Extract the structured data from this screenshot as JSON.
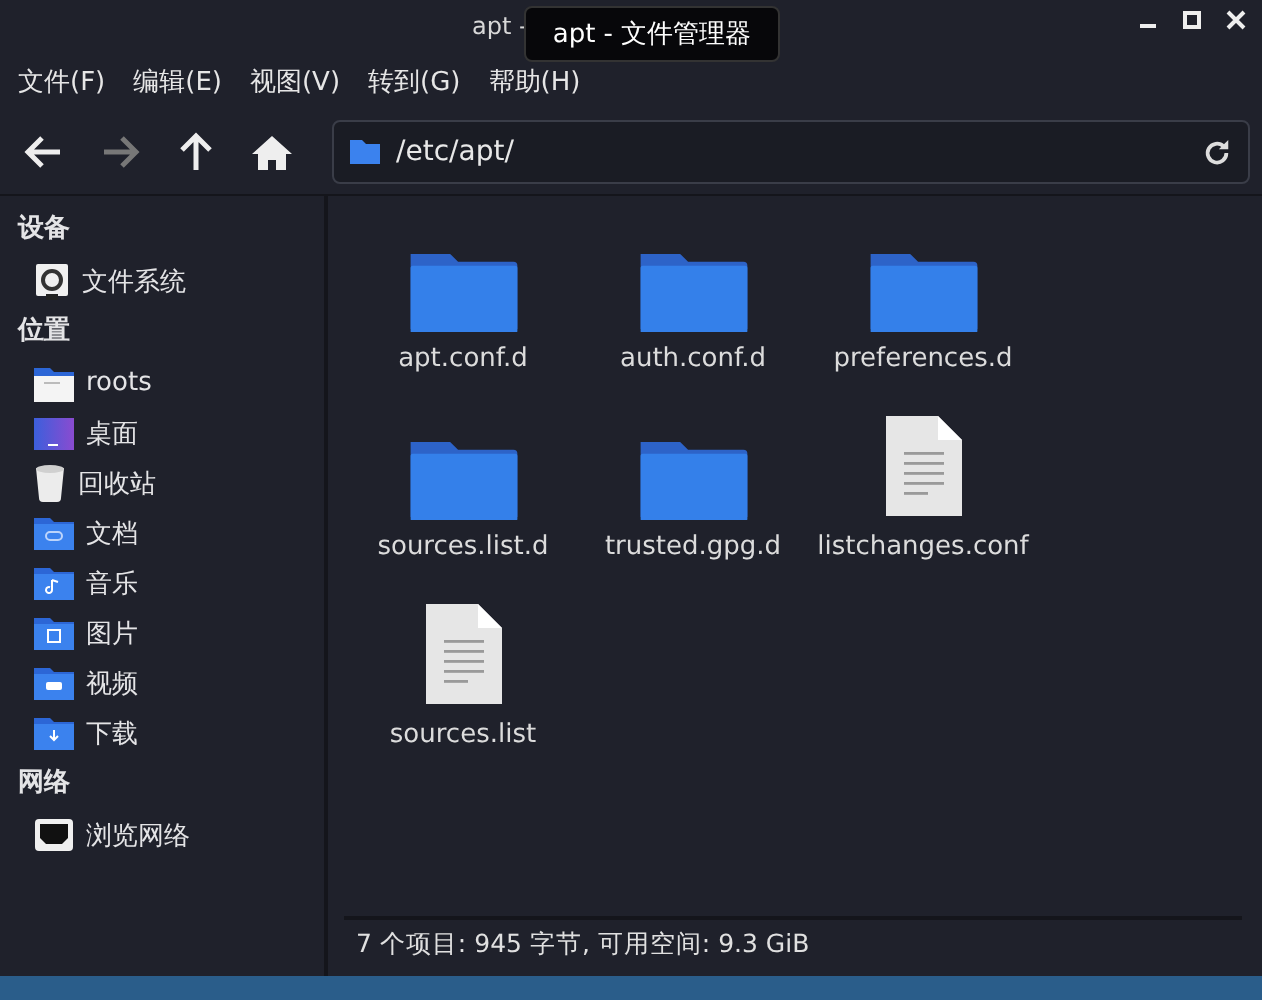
{
  "window": {
    "title": "apt -",
    "tooltip": "apt - 文件管理器"
  },
  "menu": [
    "文件(F)",
    "编辑(E)",
    "视图(V)",
    "转到(G)",
    "帮助(H)"
  ],
  "toolbar": {
    "back": {
      "disabled": false
    },
    "forward": {
      "disabled": true
    },
    "path": "/etc/apt/"
  },
  "sidebar": [
    {
      "heading": "设备",
      "items": [
        {
          "label": "文件系统",
          "kind": "drive"
        }
      ]
    },
    {
      "heading": "位置",
      "items": [
        {
          "label": "roots",
          "kind": "home"
        },
        {
          "label": "桌面",
          "kind": "desktop"
        },
        {
          "label": "回收站",
          "kind": "trash"
        },
        {
          "label": "文档",
          "kind": "documents"
        },
        {
          "label": "音乐",
          "kind": "music"
        },
        {
          "label": "图片",
          "kind": "pictures"
        },
        {
          "label": "视频",
          "kind": "videos"
        },
        {
          "label": "下载",
          "kind": "downloads"
        }
      ]
    },
    {
      "heading": "网络",
      "items": [
        {
          "label": "浏览网络",
          "kind": "network"
        }
      ]
    }
  ],
  "files": [
    {
      "name": "apt.conf.d",
      "kind": "folder"
    },
    {
      "name": "auth.conf.d",
      "kind": "folder"
    },
    {
      "name": "preferences.d",
      "kind": "folder"
    },
    {
      "name": "sources.list.d",
      "kind": "folder"
    },
    {
      "name": "trusted.gpg.d",
      "kind": "folder"
    },
    {
      "name": "listchanges.conf",
      "kind": "file"
    },
    {
      "name": "sources.list",
      "kind": "file"
    }
  ],
  "status_bar": "7 个项目: 945 字节, 可用空间: 9.3 GiB"
}
